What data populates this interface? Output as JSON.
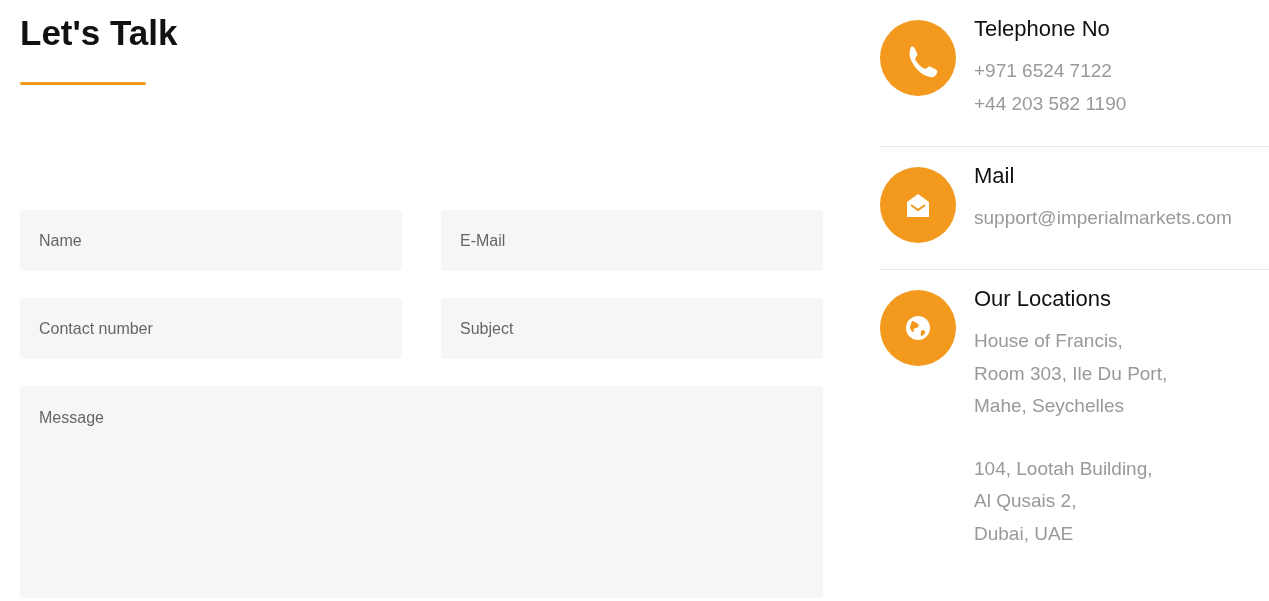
{
  "title": "Let's Talk",
  "form": {
    "fields": [
      {
        "kind": "input",
        "placeholder": "Name"
      },
      {
        "kind": "input",
        "placeholder": "E-Mail"
      },
      {
        "kind": "input",
        "placeholder": "Contact number"
      },
      {
        "kind": "input",
        "placeholder": "Subject"
      },
      {
        "kind": "textarea",
        "placeholder": "Message"
      }
    ]
  },
  "contacts": [
    {
      "kind": "phone",
      "heading": "Telephone No",
      "blocks": [
        [
          "+971 6524 7122",
          "+44 203 582 1190"
        ]
      ]
    },
    {
      "kind": "mail",
      "heading": "Mail",
      "blocks": [
        [
          "support@imperialmarkets.com"
        ]
      ]
    },
    {
      "kind": "location",
      "heading": "Our Locations",
      "blocks": [
        [
          "House of Francis,",
          "Room 303, Ile Du Port,",
          "Mahe, Seychelles"
        ],
        [
          "104, Lootah Building,",
          "Al Qusais 2,",
          "Dubai, UAE"
        ]
      ]
    }
  ]
}
